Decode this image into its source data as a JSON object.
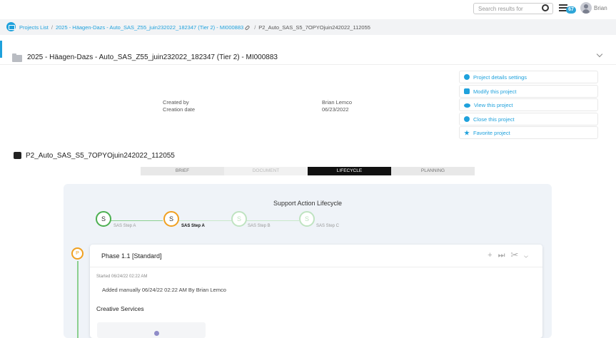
{
  "topbar": {
    "search_placeholder": "Search results for",
    "badge_count": "67",
    "user_name": "Brian"
  },
  "breadcrumb": {
    "items": [
      "Projects List",
      "2025 - Häagen-Dazs - Auto_SAS_Z55_juin232022_182347 (Tier 2) - MI000883",
      "P2_Auto_SAS_S5_7OPYOjuin242022_112055"
    ]
  },
  "project": {
    "title": "2025 - Häagen-Dazs - Auto_SAS_Z55_juin232022_182347 (Tier 2) - MI000883",
    "created_by_label": "Created by",
    "created_by_value": "Brian Lemco",
    "creation_date_label": "Creation date",
    "creation_date_value": "06/23/2022"
  },
  "actions": [
    {
      "label": "Project details settings",
      "icon": "gear-icon"
    },
    {
      "label": "Modify this project",
      "icon": "edit-icon"
    },
    {
      "label": "View this project",
      "icon": "eye-icon"
    },
    {
      "label": "Close this project",
      "icon": "globe-icon"
    },
    {
      "label": "Favorite project",
      "icon": "star-icon"
    }
  ],
  "subproject": {
    "title": "P2_Auto_SAS_S5_7OPYOjuin242022_112055"
  },
  "tabs": [
    {
      "label": "BRIEF",
      "state": "normal"
    },
    {
      "label": "DOCUMENT",
      "state": "disabled"
    },
    {
      "label": "LIFECYCLE",
      "state": "active"
    },
    {
      "label": "PLANNING",
      "state": "normal"
    }
  ],
  "lifecycle": {
    "title": "Support Action Lifecycle",
    "steps": [
      {
        "letter": "S",
        "label": "SAS Step A",
        "state": "done"
      },
      {
        "letter": "S",
        "label": "SAS Step A",
        "state": "current"
      },
      {
        "letter": "S",
        "label": "SAS Step B",
        "state": "future"
      },
      {
        "letter": "S",
        "label": "SAS Step C",
        "state": "future"
      }
    ]
  },
  "phase": {
    "marker": "P",
    "title": "Phase 1.1 [Standard]",
    "started": "Started 06/24/22 02:22 AM",
    "added": "Added manually 06/24/22 02:22 AM By Brian Lemco",
    "section": "Creative Services"
  },
  "colors": {
    "accent": "#1ea1dc",
    "step_done": "#4caf50",
    "step_current": "#f0a020",
    "tab_active": "#111111"
  }
}
